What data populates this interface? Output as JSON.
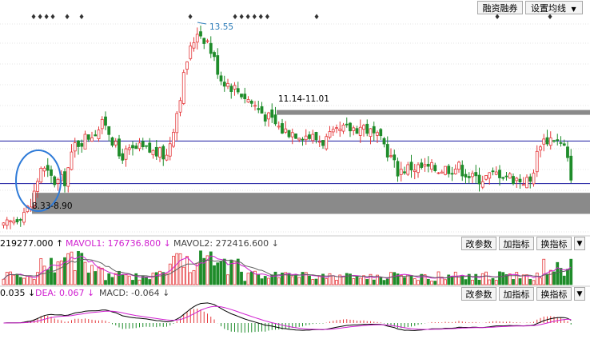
{
  "toolbar": {
    "margin_trading_label": "融资融券",
    "set_ma_label": "设置均线",
    "set_ma_arrow": "▼"
  },
  "chart_data": [
    {
      "type": "candlestick",
      "title": "",
      "peak_label": "13.55",
      "resistance_zone_label": "11.14-11.01",
      "support_zone_label": "8.33-8.90",
      "zones": [
        {
          "label": "11.14-11.01",
          "low": 11.01,
          "high": 11.14
        },
        {
          "label": "8.33-8.90",
          "low": 8.33,
          "high": 8.9
        }
      ],
      "reference_lines": [
        10.3,
        9.15
      ],
      "ylim": [
        7.8,
        13.9
      ],
      "event_markers": [
        "♦♦♦",
        "♦",
        "♦",
        "♦",
        "♦",
        "♦♦♦♦♦♦",
        "♦",
        "♦"
      ],
      "colors": {
        "up": "#e5383b",
        "down": "#1e8c2a",
        "zone": "#8a8a8a",
        "ref_line": "#1a1aa0",
        "circle": "#2f7bd8"
      }
    },
    {
      "type": "bar",
      "title": "",
      "vol_label": "219277.000 ↑",
      "mavol1_label": "MAVOL1: 176736.800 ↓",
      "mavol2_label": "MAVOL2: 272416.600 ↓",
      "buttons": [
        "改参数",
        "加指标",
        "换指标"
      ],
      "colors": {
        "up": "#e5383b",
        "down": "#1e8c2a",
        "mavol1": "#d020d0",
        "mavol2": "#606060"
      }
    },
    {
      "type": "line",
      "title": "",
      "diff_label": "0.035 ↓",
      "dea_label": "DEA: 0.067 ↓",
      "macd_label": "MACD: -0.064 ↓",
      "buttons": [
        "改参数",
        "加指标",
        "换指标"
      ],
      "colors": {
        "diff": "#000000",
        "dea": "#d020d0",
        "pos": "#e5383b",
        "neg": "#1e8c2a"
      }
    }
  ]
}
